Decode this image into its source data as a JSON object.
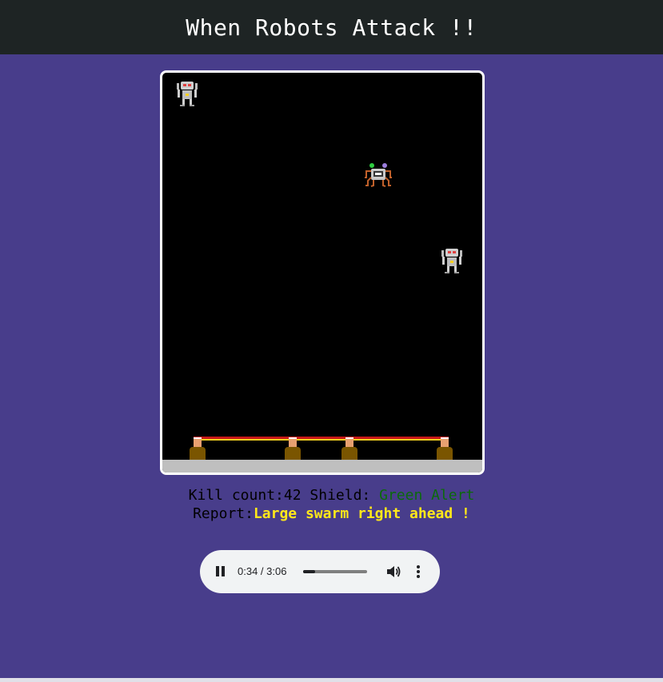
{
  "page": {
    "title": "When Robots Attack !!"
  },
  "game": {
    "sprites": {
      "robot_icon": "robot-icon",
      "invader_icon": "spider-robot-icon"
    },
    "colors": {
      "background": "#000000",
      "ground": "#bfbfbf",
      "shield_red": "#c81818",
      "shield_yellow": "#f4d020",
      "turret_base": "#7a5500",
      "page_background": "#483d8b",
      "header_background": "#1e2424"
    }
  },
  "stats": {
    "kill_label": "Kill count:",
    "kill_count": "42",
    "shield_label": " Shield: ",
    "shield_status": "Green Alert",
    "report_label": "Report:",
    "report_text": "Large swarm right ahead !"
  },
  "audio": {
    "time": "0:34 / 3:06",
    "progress": 0.183,
    "state": "playing"
  }
}
